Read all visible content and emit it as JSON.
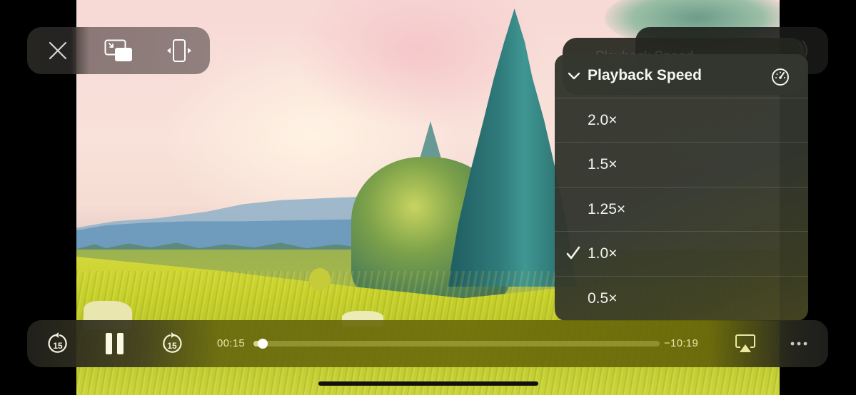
{
  "top_controls": {
    "buttons": [
      {
        "name": "close",
        "icon": "close-icon"
      },
      {
        "name": "picture-in-picture",
        "icon": "pip-icon"
      },
      {
        "name": "aspect-fit",
        "icon": "aspect-ratio-icon"
      }
    ]
  },
  "menu": {
    "title": "Playback Speed",
    "header_icon": "speedometer-icon",
    "collapse_icon": "chevron-down-icon",
    "ghost_title": "Playback Speed",
    "options": [
      {
        "label": "2.0×",
        "selected": false
      },
      {
        "label": "1.5×",
        "selected": false
      },
      {
        "label": "1.25×",
        "selected": false
      },
      {
        "label": "1.0×",
        "selected": true
      },
      {
        "label": "0.5×",
        "selected": false
      }
    ]
  },
  "playback": {
    "skip_back_seconds": "15",
    "skip_forward_seconds": "15",
    "elapsed": "00:15",
    "remaining": "−10:19",
    "progress_fraction": 0.023,
    "state": "playing"
  },
  "bottom_bar": {
    "icons": [
      "skip-back-15-icon",
      "pause-icon",
      "skip-forward-15-icon",
      "airplay-icon",
      "more-icon"
    ]
  },
  "colors": {
    "accent_text": "#e8e6a8",
    "menu_bg": "#343830",
    "bar_tint": "#6c6c0a"
  }
}
